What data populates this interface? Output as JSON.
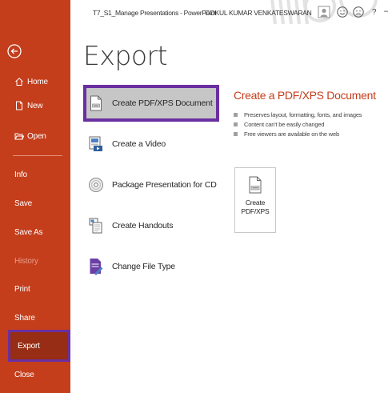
{
  "titlebar": {
    "doc_title": "T7_S1_Manage Presentations  -  PowerPoint",
    "user_name": "GOKUL KUMAR VENKATESWARAN",
    "help": "?",
    "minimize": "–"
  },
  "sidebar": {
    "items": [
      {
        "label": "Home",
        "icon": "home-icon"
      },
      {
        "label": "New",
        "icon": "new-document-icon"
      },
      {
        "label": "Open",
        "icon": "open-folder-icon"
      },
      {
        "label": "Info"
      },
      {
        "label": "Save"
      },
      {
        "label": "Save As"
      },
      {
        "label": "History"
      },
      {
        "label": "Print"
      },
      {
        "label": "Share"
      },
      {
        "label": "Export"
      },
      {
        "label": "Close"
      }
    ]
  },
  "page_title": "Export",
  "options": [
    {
      "label": "Create PDF/XPS Document",
      "icon": "pdf-document-icon",
      "selected": true
    },
    {
      "label": "Create a Video",
      "icon": "video-icon"
    },
    {
      "label": "Package Presentation for CD",
      "icon": "cd-icon"
    },
    {
      "label": "Create Handouts",
      "icon": "handouts-icon"
    },
    {
      "label": "Change File Type",
      "icon": "change-file-type-icon"
    }
  ],
  "panel": {
    "title": "Create a PDF/XPS Document",
    "bullets": [
      "Preserves layout, formatting, fonts, and images",
      "Content can't be easily changed",
      "Free viewers are available on the web"
    ],
    "button_line1": "Create",
    "button_line2": "PDF/XPS"
  },
  "colors": {
    "sidebar": "#c43e1c",
    "sidebar_selected": "#962d14",
    "highlight_border": "#6a2fa0",
    "accent_text": "#c43e1c",
    "selected_option_bg": "#c6c6c6"
  }
}
